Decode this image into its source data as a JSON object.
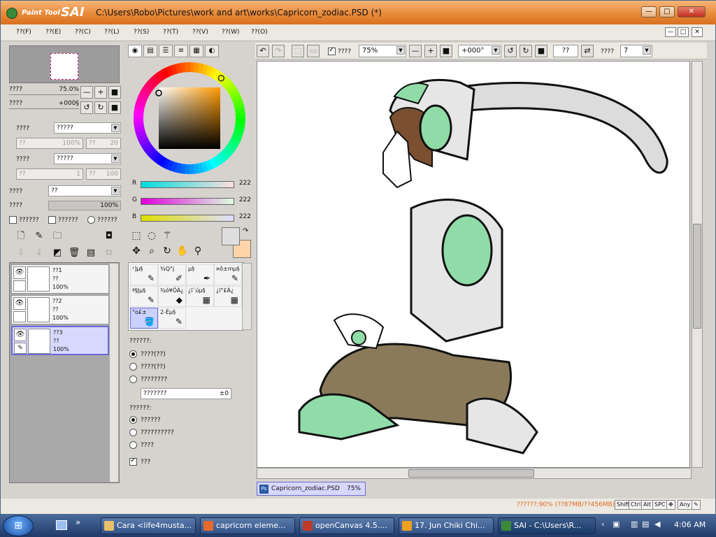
{
  "window": {
    "logo_paint": "Paint Tool",
    "logo_sai": "SAI",
    "title": "C:\\Users\\Robo\\Pictures\\work and art\\works\\Capricorn_zodiac.PSD (*)",
    "btn_min": "—",
    "btn_max": "□",
    "btn_close": "✕"
  },
  "menubar": {
    "items": [
      "??(F)",
      "??(E)",
      "??(C)",
      "??(L)",
      "??(S)",
      "??(T)",
      "??(V)",
      "??(W)",
      "??(O)"
    ],
    "mdi_min": "—",
    "mdi_max": "□",
    "mdi_close": "✕"
  },
  "navigator": {
    "zoom_label": "????",
    "zoom_value": "75.0%",
    "angle_label": "????",
    "angle_value": "+000§",
    "btn_zoom_out": "—",
    "btn_zoom_in": "+",
    "btn_reset": "■",
    "btn_rot_left": "↺",
    "btn_rot_right": "↻",
    "btn_rot_reset": "■"
  },
  "layer_props": {
    "mode_label": "????",
    "mode_value": "?????",
    "f1": "??",
    "f1v": "100%",
    "f2": "??",
    "f2v": "20",
    "tex_label": "????",
    "tex_value": "?????",
    "f3": "??",
    "f3v": "1",
    "f4": "??",
    "f4v": "100",
    "blend_label": "????",
    "blend_value": "??",
    "opacity_label": "????",
    "opacity_value": "100%",
    "chk1": "??????",
    "chk2": "??????",
    "chk3": "??????"
  },
  "layers": [
    {
      "name": "??1",
      "mode": "??",
      "opacity": "100%"
    },
    {
      "name": "??2",
      "mode": "??",
      "opacity": "100%"
    },
    {
      "name": "??3",
      "mode": "??",
      "opacity": "100%"
    }
  ],
  "color": {
    "r_label": "R",
    "r_value": "222",
    "g_label": "G",
    "g_value": "222",
    "b_label": "B",
    "b_value": "222",
    "hue_selector_fraction": 0.25,
    "primary": "#dedede",
    "secondary": "#ffd4a8"
  },
  "brushes": [
    {
      "label": "¹]µ§",
      "icon": "✎"
    },
    {
      "label": "¾Q°j",
      "icon": "✐"
    },
    {
      "label": "µ§",
      "icon": "✒"
    },
    {
      "label": "¤ô±mµ§",
      "icon": "✎"
    },
    {
      "label": "ª§Jµ§",
      "icon": "✎"
    },
    {
      "label": "¾ó¥ÖÀ¿",
      "icon": "◆"
    },
    {
      "label": "¿ï¨úµ§",
      "icon": "▦"
    },
    {
      "label": "¿ï°£À¿",
      "icon": "▦"
    },
    {
      "label": "°o£±",
      "icon": "🪣"
    },
    {
      "label": "2-Éµ§",
      "icon": "✎"
    }
  ],
  "options": {
    "group1_label": "??????:",
    "r1": "????(??)",
    "r2": "????(??)",
    "r3": "????????",
    "field": "???????",
    "field_val": "±0",
    "group2_label": "??????:",
    "r4": "??????",
    "r5": "??????????",
    "r6": "????",
    "chk": "???"
  },
  "canvas_toolbar": {
    "btn_undo": "↶",
    "btn_redo": "↷",
    "chk_label": "????",
    "zoom": "75%",
    "angle": "+000°",
    "btn_minus": "—",
    "btn_plus": "+",
    "btn_sq": "■",
    "btn_rot_l": "↺",
    "btn_rot_r": "↻",
    "btn_rot_sq": "■",
    "flip_field": "??",
    "stab_label": "????",
    "stab_value": "7"
  },
  "doc_tab": {
    "name": "Capricorn_zodiac.PSD",
    "zoom": "75%",
    "icon": "Ps"
  },
  "status": {
    "memory": "??????:90% (??87MB/??456MB)",
    "keys": [
      "Shift",
      "Ctrl",
      "Alt",
      "SPC",
      "✥",
      "Any",
      "✎"
    ]
  },
  "taskbar": {
    "start": "⊞",
    "items": [
      {
        "label": "Cara <life4musta...",
        "color": "#e8c06a"
      },
      {
        "label": "capricorn eleme...",
        "color": "#e86a2a"
      },
      {
        "label": "openCanvas 4.5....",
        "color": "#c03a2a"
      },
      {
        "label": "17. Jun Chiki Chi...",
        "color": "#f0a020"
      },
      {
        "label": "SAI - C:\\Users\\R...",
        "color": "#3a8a3a"
      }
    ],
    "chevron": "»",
    "clock": "4:06 AM"
  }
}
